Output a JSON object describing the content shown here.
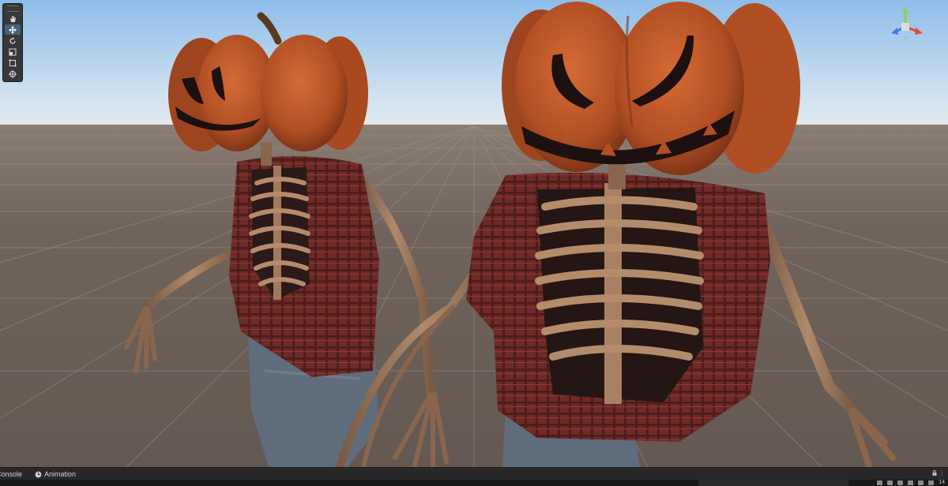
{
  "scene": {
    "camera_mode": "",
    "tools": [
      {
        "name": "hand",
        "active": false
      },
      {
        "name": "move",
        "active": true
      },
      {
        "name": "rotate",
        "active": false
      },
      {
        "name": "scale",
        "active": false
      },
      {
        "name": "rect",
        "active": false
      },
      {
        "name": "transform",
        "active": false
      }
    ]
  },
  "dock": {
    "tabs": [
      {
        "label": "Console",
        "icon": "console-icon"
      },
      {
        "label": "Animation",
        "icon": "clock-icon"
      }
    ]
  },
  "status": {
    "layer_count": "14"
  },
  "colors": {
    "sky_top": "#8ebde9",
    "sky_horizon": "#dbe6ee",
    "ground": "#6e625b",
    "pumpkin": "#c0582a",
    "cloth_red": "#7a2e28",
    "bone": "#a88062",
    "jeans": "#5f6d7d",
    "active_tool": "#46607c"
  }
}
